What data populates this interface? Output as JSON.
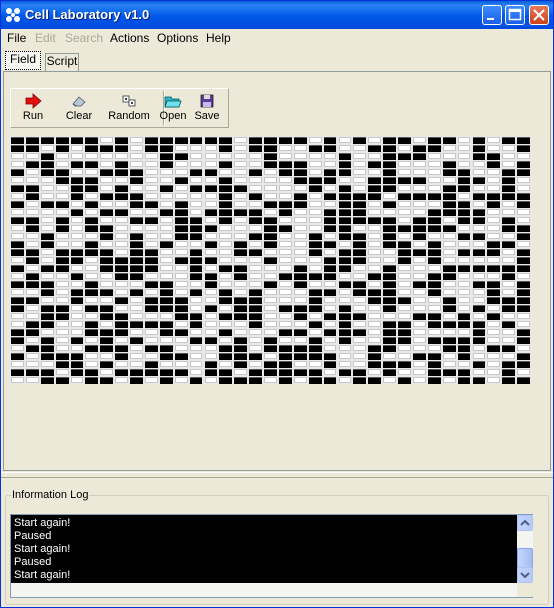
{
  "window": {
    "title": "Cell Laboratory v1.0",
    "colors": {
      "titlebar": "#0058e6",
      "face": "#ece9d8",
      "cell_on": "#000000",
      "cell_off": "#ffffff"
    }
  },
  "menu": {
    "file": "File",
    "edit": "Edit",
    "search": "Search",
    "actions": "Actions",
    "options": "Options",
    "help": "Help"
  },
  "tabs": {
    "field": "Field",
    "script": "Script"
  },
  "toolbar": {
    "run": {
      "label": "Run",
      "icon": "run-arrow-icon"
    },
    "clear": {
      "label": "Clear",
      "icon": "eraser-icon"
    },
    "random": {
      "label": "Random",
      "icon": "dice-icon"
    },
    "open": {
      "label": "Open",
      "icon": "open-folder-icon"
    },
    "save": {
      "label": "Save",
      "icon": "save-disk-icon"
    }
  },
  "field": {
    "cols": 35,
    "rows": 31,
    "cells": [
      "11111101011111101111010101101101011",
      "11010111011000101100110011011001001",
      "00100000001100000100001001110001100",
      "01101101001000100111001011000100101",
      "10110011100011001011011001000110011",
      "00011100100100100001110011110011010",
      "11001101001011110000101011000110010",
      "01001011100000101001011110111101111",
      "10110100110100100111001101000110101",
      "00001011001101111010011100001111000",
      "11010100110110101100011111011011010",
      "01010110000111000110011001111100011",
      "00100010100110001100101101010011001",
      "10100100101001010100110101101000110",
      "11011110110010011000101100111011101",
      "01011011110111000100011100101000001",
      "10110011110010110001011001000111111",
      "01001001100011010011110011001100010",
      "11100100011001000101001101011001101",
      "00101110101010101000110111001000101",
      "11001001011100111000100011100100111",
      "10110110011101011011101001000101011",
      "00110011000110111001011100011010100",
      "01100101111010001000101001101111010",
      "11000111001100100011011101100001001",
      "10101010100011010100101001101111001",
      "01100111011000110111100011000110110",
      "10111001001100111011110010011010001",
      "00011010010001010110010011101001011",
      "11101101111101101111101101001110010",
      "00110110101010111010110110101011011"
    ]
  },
  "log": {
    "title": "Information Log",
    "lines": [
      "Start again!",
      "Paused",
      "Start again!",
      "Paused",
      "Start again!"
    ]
  }
}
